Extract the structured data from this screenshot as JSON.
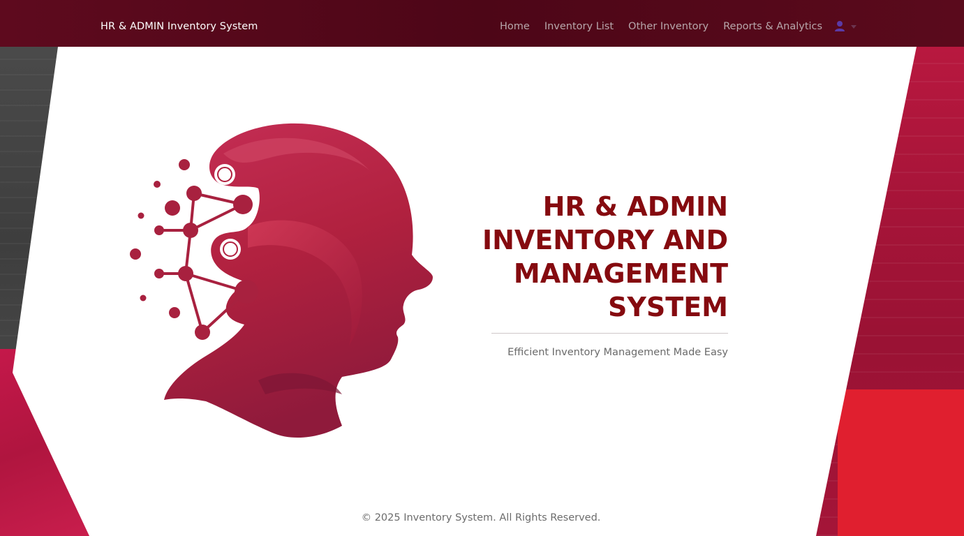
{
  "navbar": {
    "brand": "HR & ADMIN Inventory System",
    "links": [
      {
        "label": "Home"
      },
      {
        "label": "Inventory List"
      },
      {
        "label": "Other Inventory"
      },
      {
        "label": "Reports & Analytics"
      }
    ],
    "user_menu": {
      "icon": "user-icon",
      "caret": "caret-down-icon"
    }
  },
  "hero": {
    "title_lines": [
      "HR & ADMIN",
      "INVENTORY AND",
      "MANAGEMENT",
      "SYSTEM"
    ],
    "subtitle": "Efficient Inventory Management Made Easy",
    "logo_icon": "ai-head-network-logo"
  },
  "footer": {
    "text": "© 2025 Inventory System. All Rights Reserved."
  },
  "colors": {
    "navbar_bg": "#4d0617",
    "title_red": "#850a0f",
    "accent_crimson": "#b8183f",
    "accent_bright_red": "#e01f2f"
  }
}
